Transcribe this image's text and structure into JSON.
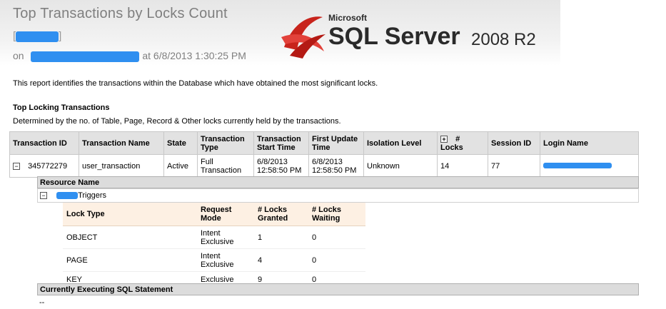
{
  "report": {
    "title": "Top Transactions by Locks Count",
    "bracket_open": "[",
    "bracket_close": "]",
    "on_label": "on",
    "timestamp": "at 6/8/2013 1:30:25 PM",
    "description": "This report identifies the transactions within the Database which have obtained the most significant locks."
  },
  "logo": {
    "company": "Microsoft",
    "product": "SQL Server",
    "version": "2008 R2"
  },
  "section": {
    "title": "Top Locking Transactions",
    "description": "Determined by the no. of Table, Page, Record & Other locks currently held by the transactions."
  },
  "transactions_table": {
    "headers": [
      "Transaction ID",
      "Transaction Name",
      "State",
      "Transaction Type",
      "Transaction Start Time",
      "First Update Time",
      "Isolation Level",
      "# Locks",
      "Session ID",
      "Login Name"
    ],
    "rows": [
      {
        "id": "345772279",
        "name": "user_transaction",
        "state": "Active",
        "type": "Full Transaction",
        "start": "6/8/2013 12:58:50 PM",
        "first_update": "6/8/2013 12:58:50 PM",
        "isolation": "Unknown",
        "locks": "14",
        "session": "77"
      }
    ]
  },
  "resource": {
    "header": "Resource Name",
    "item": "Triggers"
  },
  "locks_table": {
    "headers": [
      "Lock Type",
      "Request Mode",
      "# Locks Granted",
      "# Locks Waiting"
    ],
    "rows": [
      {
        "type": "OBJECT",
        "mode": "Intent Exclusive",
        "granted": "1",
        "waiting": "0"
      },
      {
        "type": "PAGE",
        "mode": "Intent Exclusive",
        "granted": "4",
        "waiting": "0"
      },
      {
        "type": "KEY",
        "mode": "Exclusive",
        "granted": "9",
        "waiting": "0"
      }
    ]
  },
  "sql_statement": {
    "header": "Currently Executing SQL Statement",
    "text": "--"
  },
  "colors": {
    "redaction": "#2f8ff0",
    "header_bg": "#e2e2e2",
    "lock_header_bg": "#fdf0e3"
  }
}
